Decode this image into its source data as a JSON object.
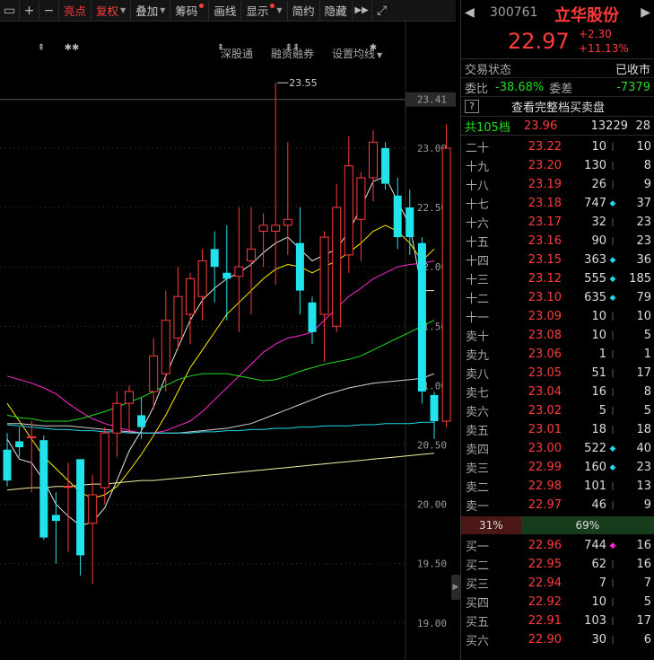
{
  "toolbar": {
    "items": [
      {
        "label": "亮点",
        "highlight": true,
        "dropdown": false,
        "dot": false
      },
      {
        "label": "复权",
        "highlight": true,
        "dropdown": true,
        "dot": false
      },
      {
        "label": "叠加",
        "highlight": false,
        "dropdown": true,
        "dot": false
      },
      {
        "label": "筹码",
        "highlight": false,
        "dropdown": false,
        "dot": true
      },
      {
        "label": "画线",
        "highlight": false,
        "dropdown": false,
        "dot": false
      },
      {
        "label": "显示",
        "highlight": false,
        "dropdown": true,
        "dot": true
      },
      {
        "label": "简约",
        "highlight": false,
        "dropdown": false,
        "dot": false
      },
      {
        "label": "隐藏",
        "highlight": false,
        "dropdown": false,
        "dot": false
      }
    ]
  },
  "chart_menu": {
    "shenguto": "深股通",
    "margin": "融资融券",
    "ma_settings": "设置均线"
  },
  "chart_data": {
    "type": "candlestick",
    "ylim": [
      18.9,
      23.65
    ],
    "ytick_labels": [
      "23.41",
      "23.00",
      "22.50",
      "22.00",
      "21.50",
      "21.00",
      "20.50",
      "20.00",
      "19.50",
      "19.00"
    ],
    "current_price_label": "23.41",
    "max_annotation": "23.55",
    "markers": [
      "⇞",
      "✱✱",
      "⇞",
      "⇞⇞",
      "✱"
    ],
    "candles": [
      {
        "o": 20.46,
        "h": 20.6,
        "l": 20.15,
        "c": 20.2
      },
      {
        "o": 20.53,
        "h": 20.65,
        "l": 20.4,
        "c": 20.48
      },
      {
        "o": 20.56,
        "h": 20.7,
        "l": 20.1,
        "c": 20.57
      },
      {
        "o": 20.54,
        "h": 20.58,
        "l": 19.7,
        "c": 19.72
      },
      {
        "o": 19.91,
        "h": 20.1,
        "l": 19.5,
        "c": 19.86
      },
      {
        "o": 20.15,
        "h": 20.35,
        "l": 19.6,
        "c": 20.15
      },
      {
        "o": 20.38,
        "h": 20.38,
        "l": 19.4,
        "c": 19.57
      },
      {
        "o": 19.84,
        "h": 20.25,
        "l": 19.33,
        "c": 20.08
      },
      {
        "o": 20.14,
        "h": 20.65,
        "l": 20.0,
        "c": 20.6
      },
      {
        "o": 20.6,
        "h": 20.95,
        "l": 20.4,
        "c": 20.85
      },
      {
        "o": 20.85,
        "h": 21.0,
        "l": 20.6,
        "c": 20.95
      },
      {
        "o": 20.75,
        "h": 20.9,
        "l": 20.55,
        "c": 20.65
      },
      {
        "o": 20.95,
        "h": 21.4,
        "l": 20.8,
        "c": 21.25
      },
      {
        "o": 21.1,
        "h": 21.8,
        "l": 20.95,
        "c": 21.55
      },
      {
        "o": 21.4,
        "h": 22.0,
        "l": 21.3,
        "c": 21.75
      },
      {
        "o": 21.6,
        "h": 21.95,
        "l": 21.35,
        "c": 21.9
      },
      {
        "o": 21.75,
        "h": 22.15,
        "l": 21.55,
        "c": 22.05
      },
      {
        "o": 22.15,
        "h": 22.3,
        "l": 21.7,
        "c": 22.0
      },
      {
        "o": 21.95,
        "h": 22.35,
        "l": 21.55,
        "c": 21.9
      },
      {
        "o": 21.92,
        "h": 22.5,
        "l": 21.45,
        "c": 22.0
      },
      {
        "o": 22.05,
        "h": 22.5,
        "l": 21.6,
        "c": 22.15
      },
      {
        "o": 22.3,
        "h": 22.45,
        "l": 22.0,
        "c": 22.35
      },
      {
        "o": 22.3,
        "h": 23.55,
        "l": 21.85,
        "c": 22.35
      },
      {
        "o": 22.35,
        "h": 23.05,
        "l": 22.1,
        "c": 22.4
      },
      {
        "o": 22.2,
        "h": 22.5,
        "l": 21.6,
        "c": 21.8
      },
      {
        "o": 21.7,
        "h": 21.75,
        "l": 21.35,
        "c": 21.45
      },
      {
        "o": 21.6,
        "h": 22.3,
        "l": 21.2,
        "c": 22.25
      },
      {
        "o": 21.5,
        "h": 22.7,
        "l": 21.45,
        "c": 22.5
      },
      {
        "o": 22.1,
        "h": 23.1,
        "l": 21.95,
        "c": 22.85
      },
      {
        "o": 22.4,
        "h": 22.8,
        "l": 22.05,
        "c": 22.75
      },
      {
        "o": 22.75,
        "h": 23.15,
        "l": 22.55,
        "c": 23.05
      },
      {
        "o": 23.0,
        "h": 23.05,
        "l": 22.65,
        "c": 22.7
      },
      {
        "o": 22.6,
        "h": 22.75,
        "l": 22.15,
        "c": 22.25
      },
      {
        "o": 22.5,
        "h": 22.65,
        "l": 22.1,
        "c": 22.25
      },
      {
        "o": 22.2,
        "h": 22.25,
        "l": 20.85,
        "c": 20.95
      },
      {
        "o": 20.92,
        "h": 20.95,
        "l": 20.55,
        "c": 20.7
      },
      {
        "o": 20.7,
        "h": 23.2,
        "l": 20.65,
        "c": 23.0
      }
    ],
    "ma": [
      {
        "name": "ma5",
        "color": "#e6e6e6",
        "values": [
          20.55,
          20.38,
          20.35,
          20.2,
          20.0,
          19.9,
          19.82,
          19.85,
          19.97,
          20.2,
          20.45,
          20.62,
          20.82,
          21.08,
          21.32,
          21.55,
          21.72,
          21.82,
          21.9,
          21.95,
          22.02,
          22.12,
          22.2,
          22.25,
          22.15,
          22.05,
          22.1,
          22.15,
          22.3,
          22.5,
          22.72,
          22.76,
          22.55,
          22.35,
          21.8,
          21.8
        ]
      },
      {
        "name": "ma10",
        "color": "#ffee00",
        "values": [
          20.85,
          20.7,
          20.55,
          20.4,
          20.3,
          20.2,
          20.1,
          20.05,
          20.08,
          20.15,
          20.28,
          20.42,
          20.58,
          20.75,
          20.95,
          21.15,
          21.3,
          21.45,
          21.6,
          21.7,
          21.8,
          21.9,
          21.98,
          22.02,
          22.0,
          21.95,
          22.0,
          22.05,
          22.12,
          22.2,
          22.3,
          22.35,
          22.3,
          22.2,
          22.05,
          22.15
        ]
      },
      {
        "name": "ma20",
        "color": "#ff2ad4",
        "values": [
          21.08,
          21.05,
          21.02,
          20.98,
          20.93,
          20.85,
          20.78,
          20.72,
          20.68,
          20.65,
          20.62,
          20.6,
          20.6,
          20.62,
          20.66,
          20.7,
          20.78,
          20.88,
          20.98,
          21.08,
          21.18,
          21.28,
          21.35,
          21.4,
          21.42,
          21.45,
          21.55,
          21.65,
          21.75,
          21.82,
          21.9,
          21.95,
          22.0,
          22.02,
          22.03,
          22.05
        ]
      },
      {
        "name": "ma30",
        "color": "#22dd22",
        "values": [
          20.75,
          20.73,
          20.72,
          20.7,
          20.7,
          20.7,
          20.72,
          20.75,
          20.78,
          20.82,
          20.86,
          20.9,
          20.95,
          21.0,
          21.05,
          21.08,
          21.1,
          21.1,
          21.1,
          21.08,
          21.06,
          21.04,
          21.05,
          21.08,
          21.12,
          21.15,
          21.18,
          21.2,
          21.22,
          21.25,
          21.3,
          21.35,
          21.4,
          21.45,
          21.5,
          21.55
        ]
      },
      {
        "name": "ma60",
        "color": "#cfcfcf",
        "values": [
          20.68,
          20.68,
          20.67,
          20.66,
          20.66,
          20.66,
          20.65,
          20.64,
          20.63,
          20.62,
          20.61,
          20.6,
          20.6,
          20.6,
          20.6,
          20.61,
          20.62,
          20.63,
          20.64,
          20.66,
          20.68,
          20.72,
          20.76,
          20.8,
          20.84,
          20.88,
          20.92,
          20.95,
          20.98,
          21.0,
          21.02,
          21.03,
          21.04,
          21.05,
          21.06,
          21.1
        ]
      },
      {
        "name": "ma120",
        "color": "#21d8e8",
        "values": [
          20.67,
          20.66,
          20.65,
          20.64,
          20.63,
          20.63,
          20.62,
          20.62,
          20.61,
          20.61,
          20.6,
          20.6,
          20.6,
          20.6,
          20.6,
          20.6,
          20.61,
          20.61,
          20.62,
          20.62,
          20.63,
          20.63,
          20.64,
          20.64,
          20.65,
          20.65,
          20.66,
          20.66,
          20.66,
          20.67,
          20.67,
          20.68,
          20.68,
          20.68,
          20.69,
          20.69
        ]
      },
      {
        "name": "ma250",
        "color": "#f4f0a0",
        "values": [
          20.12,
          20.13,
          20.14,
          20.14,
          20.15,
          20.15,
          20.16,
          20.17,
          20.17,
          20.18,
          20.19,
          20.2,
          20.2,
          20.21,
          20.22,
          20.23,
          20.24,
          20.25,
          20.26,
          20.27,
          20.28,
          20.29,
          20.3,
          20.31,
          20.32,
          20.33,
          20.34,
          20.35,
          20.36,
          20.37,
          20.38,
          20.39,
          20.4,
          20.41,
          20.42,
          20.43
        ]
      }
    ]
  },
  "panel": {
    "code": "300761",
    "name": "立华股份",
    "price": "22.97",
    "change": "+2.30",
    "change_pct": "+11.13%",
    "status_label": "交易状态",
    "status_value": "已收市",
    "wb_label": "委比",
    "wb_value": "-38.68%",
    "wc_label": "委差",
    "wc_value": "-7379",
    "detail_icon": "?",
    "detail_text": "查看完整档买卖盘",
    "total_label": "共105档",
    "total_price": "23.96",
    "total_vol": "13229",
    "total_count": "28",
    "asks": [
      {
        "label": "二十",
        "price": "23.22",
        "vol": "10",
        "marker": "gray",
        "count": "10"
      },
      {
        "label": "十九",
        "price": "23.20",
        "vol": "130",
        "marker": "gray",
        "count": "8"
      },
      {
        "label": "十八",
        "price": "23.19",
        "vol": "26",
        "marker": "gray",
        "count": "9"
      },
      {
        "label": "十七",
        "price": "23.18",
        "vol": "747",
        "marker": "cyan",
        "count": "37"
      },
      {
        "label": "十六",
        "price": "23.17",
        "vol": "32",
        "marker": "gray",
        "count": "23"
      },
      {
        "label": "十五",
        "price": "23.16",
        "vol": "90",
        "marker": "gray",
        "count": "23"
      },
      {
        "label": "十四",
        "price": "23.15",
        "vol": "363",
        "marker": "cyan",
        "count": "36"
      },
      {
        "label": "十三",
        "price": "23.12",
        "vol": "555",
        "marker": "cyan",
        "count": "185"
      },
      {
        "label": "十二",
        "price": "23.10",
        "vol": "635",
        "marker": "cyan",
        "count": "79"
      },
      {
        "label": "十一",
        "price": "23.09",
        "vol": "10",
        "marker": "gray",
        "count": "10"
      },
      {
        "label": "卖十",
        "price": "23.08",
        "vol": "10",
        "marker": "gray",
        "count": "5"
      },
      {
        "label": "卖九",
        "price": "23.06",
        "vol": "1",
        "marker": "gray",
        "count": "1"
      },
      {
        "label": "卖八",
        "price": "23.05",
        "vol": "51",
        "marker": "gray",
        "count": "17"
      },
      {
        "label": "卖七",
        "price": "23.04",
        "vol": "16",
        "marker": "gray",
        "count": "8"
      },
      {
        "label": "卖六",
        "price": "23.02",
        "vol": "5",
        "marker": "gray",
        "count": "5"
      },
      {
        "label": "卖五",
        "price": "23.01",
        "vol": "18",
        "marker": "gray",
        "count": "18"
      },
      {
        "label": "卖四",
        "price": "23.00",
        "vol": "522",
        "marker": "cyan",
        "count": "40"
      },
      {
        "label": "卖三",
        "price": "22.99",
        "vol": "160",
        "marker": "cyan",
        "count": "23"
      },
      {
        "label": "卖二",
        "price": "22.98",
        "vol": "101",
        "marker": "gray",
        "count": "13"
      },
      {
        "label": "卖一",
        "price": "22.97",
        "vol": "46",
        "marker": "gray",
        "count": "9"
      }
    ],
    "ratio_sell": "31%",
    "ratio_buy": "69%",
    "bids": [
      {
        "label": "买一",
        "price": "22.96",
        "vol": "744",
        "marker": "magenta",
        "count": "16"
      },
      {
        "label": "买二",
        "price": "22.95",
        "vol": "62",
        "marker": "gray",
        "count": "16"
      },
      {
        "label": "买三",
        "price": "22.94",
        "vol": "7",
        "marker": "gray",
        "count": "7"
      },
      {
        "label": "买四",
        "price": "22.92",
        "vol": "10",
        "marker": "gray",
        "count": "5"
      },
      {
        "label": "买五",
        "price": "22.91",
        "vol": "103",
        "marker": "gray",
        "count": "17"
      },
      {
        "label": "买六",
        "price": "22.90",
        "vol": "30",
        "marker": "gray",
        "count": "6"
      }
    ]
  }
}
